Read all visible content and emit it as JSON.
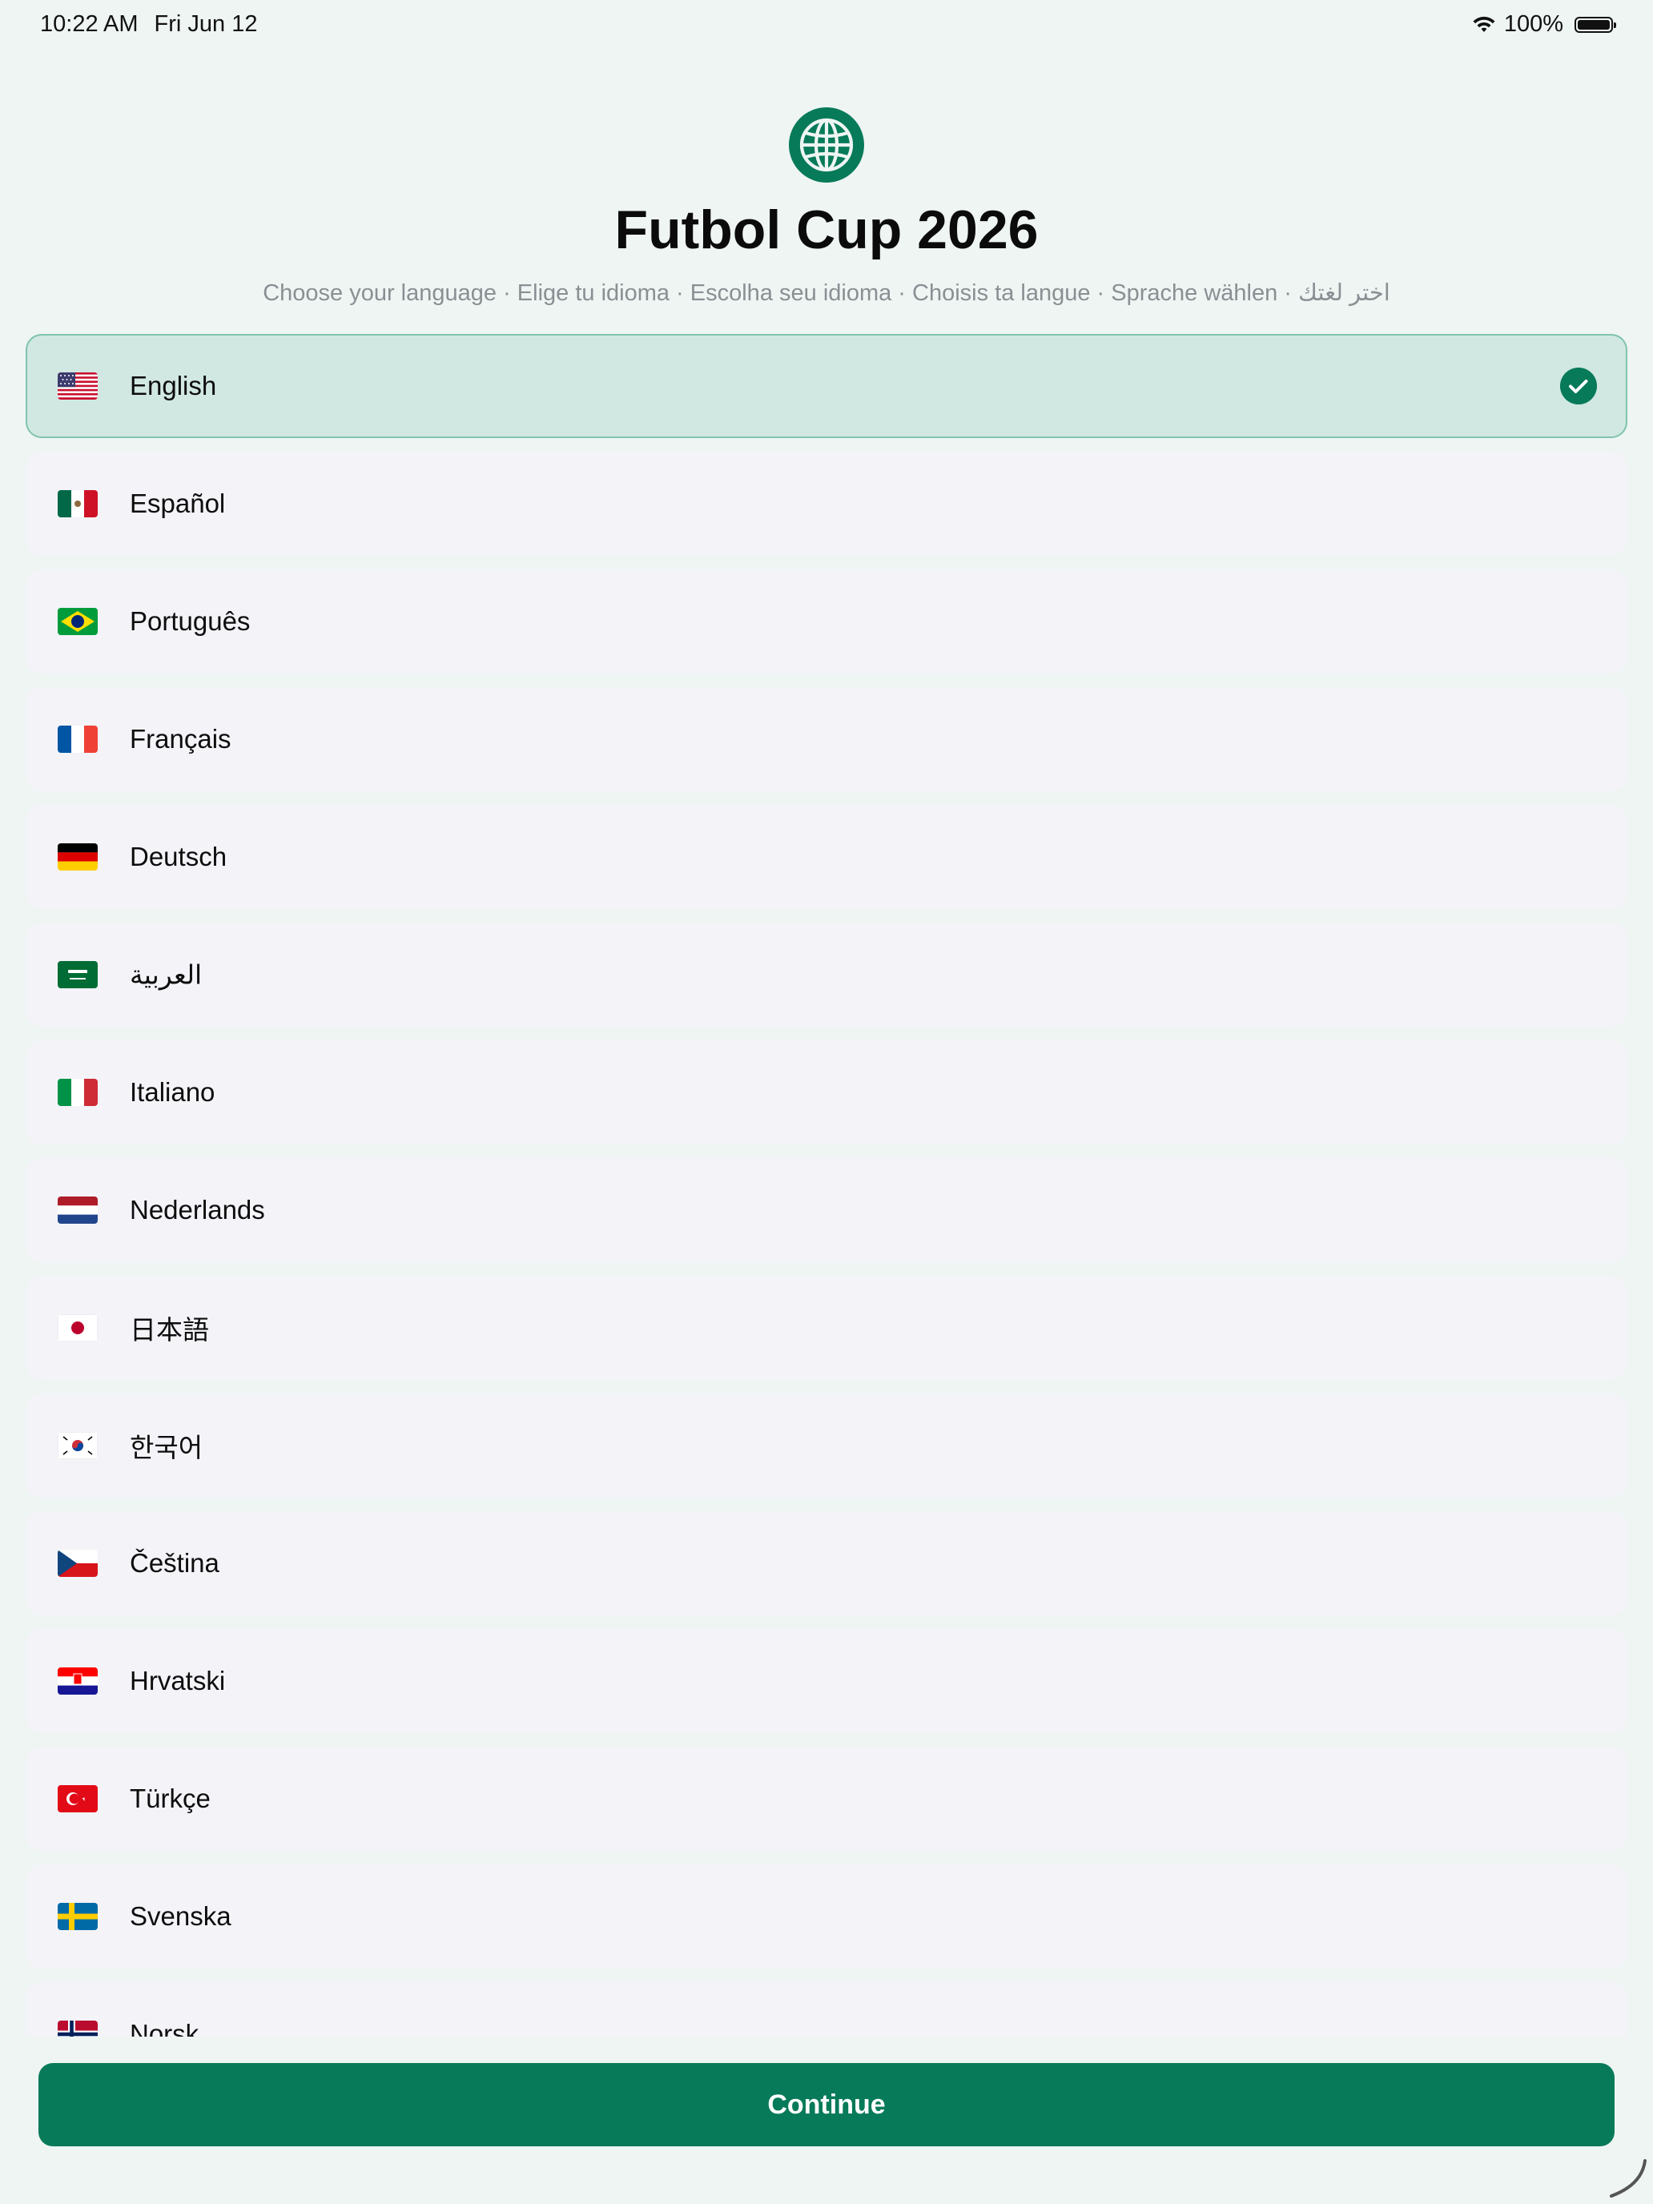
{
  "status": {
    "time": "10:22 AM",
    "date": "Fri Jun 12",
    "battery": "100%"
  },
  "header": {
    "title": "Futbol Cup 2026",
    "subtitle": "Choose your language · Elige tu idioma · Escolha seu idioma · Choisis ta langue · Sprache wählen · اختر لغتك"
  },
  "languages": [
    {
      "label": "English",
      "flag": "us-flag",
      "selected": true
    },
    {
      "label": "Español",
      "flag": "mexico-flag"
    },
    {
      "label": "Português",
      "flag": "brazil-flag"
    },
    {
      "label": "Français",
      "flag": "france-flag"
    },
    {
      "label": "Deutsch",
      "flag": "germany-flag"
    },
    {
      "label": "العربية",
      "flag": "saudi-arabia-flag"
    },
    {
      "label": "Italiano",
      "flag": "italy-flag"
    },
    {
      "label": "Nederlands",
      "flag": "netherlands-flag"
    },
    {
      "label": "日本語",
      "flag": "japan-flag"
    },
    {
      "label": "한국어",
      "flag": "south-korea-flag"
    },
    {
      "label": "Čeština",
      "flag": "czech-flag"
    },
    {
      "label": "Hrvatski",
      "flag": "croatia-flag"
    },
    {
      "label": "Türkçe",
      "flag": "turkey-flag"
    },
    {
      "label": "Svenska",
      "flag": "sweden-flag"
    },
    {
      "label": "Norsk",
      "flag": "norway-flag"
    }
  ],
  "footer": {
    "continue_label": "Continue"
  },
  "colors": {
    "accent": "#077a59",
    "selected_bg": "#d1e7e2",
    "row_bg": "#f3f3f8",
    "page_bg": "#eef5f3"
  }
}
